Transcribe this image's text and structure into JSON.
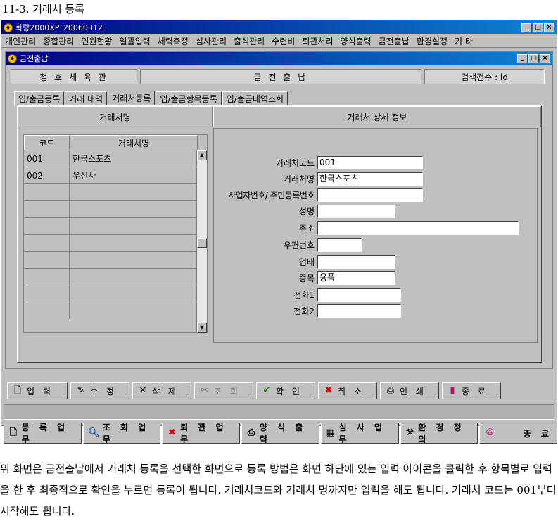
{
  "heading": "11-3. 거래처 등록",
  "app": {
    "title": "화랑2000XP_20060312",
    "menu": [
      "개인관리",
      "종합관리",
      "인원현황",
      "일괄입력",
      "체력측정",
      "심사관리",
      "출석관리",
      "수련비",
      "퇴관처리",
      "양식출력",
      "금전출납",
      "환경설정",
      "기 타"
    ]
  },
  "child": {
    "title": "금전출납",
    "info": {
      "gym": "청 호 체 육 관",
      "module": "금 전 출 납",
      "count": "검색건수 : id"
    },
    "tabs": [
      "입/출금등록",
      "거래 내역",
      "거래처등록",
      "입/출금항목등록",
      "입/출금내역조회"
    ],
    "panel_left_title": "거래처명",
    "panel_right_title": "거래처 상세 정보",
    "grid": {
      "headers": [
        "코드",
        "거래처명"
      ],
      "rows": [
        {
          "code": "001",
          "name": "한국스포츠"
        },
        {
          "code": "002",
          "name": "우신사"
        }
      ]
    },
    "form": {
      "code_label": "거래처코드",
      "code_value": "001",
      "name_label": "거래처명",
      "name_value": "한국스포츠",
      "bizno_label": "사업자번호/ 주민등록번호",
      "bizno_value": "",
      "person_label": "성명",
      "person_value": "",
      "addr_label": "주소",
      "addr_value": "",
      "zip_label": "우편번호",
      "zip_value": "",
      "biztype_label": "업태",
      "biztype_value": "",
      "item_label": "종목",
      "item_value": "용품",
      "tel1_label": "전화1",
      "tel1_value": "",
      "tel2_label": "전화2",
      "tel2_value": ""
    }
  },
  "toolbar": {
    "input": "입 력",
    "edit": "수 정",
    "delete": "삭 제",
    "search": "조 회",
    "confirm": "확 인",
    "cancel": "취 소",
    "print": "인 쇄",
    "exit": "종 료"
  },
  "bottombar": {
    "register": "등 록 업 무",
    "query": "조 회 업 무",
    "leave": "퇴 관 업 무",
    "forms": "양 식 출 력",
    "exam": "심 사 업 무",
    "env": "환 경 정 의",
    "exit": "종 료"
  },
  "colors": {
    "title_start": "#000080",
    "title_end": "#1084d0",
    "face": "#c0c0c0"
  },
  "paragraph": "위 화면은 금전출납에서 거래처 등록을 선택한 화면으로 등록 방법은 화면 하단에 있는 입력 아이콘을 클릭한 후 항목별로 입력을 한 후 최종적으로 확인을 누르면 등록이 됩니다. 거래처코드와 거래처 명까지만 입력을 해도 됩니다. 거래처 코드는 001부터 시작해도 됩니다."
}
